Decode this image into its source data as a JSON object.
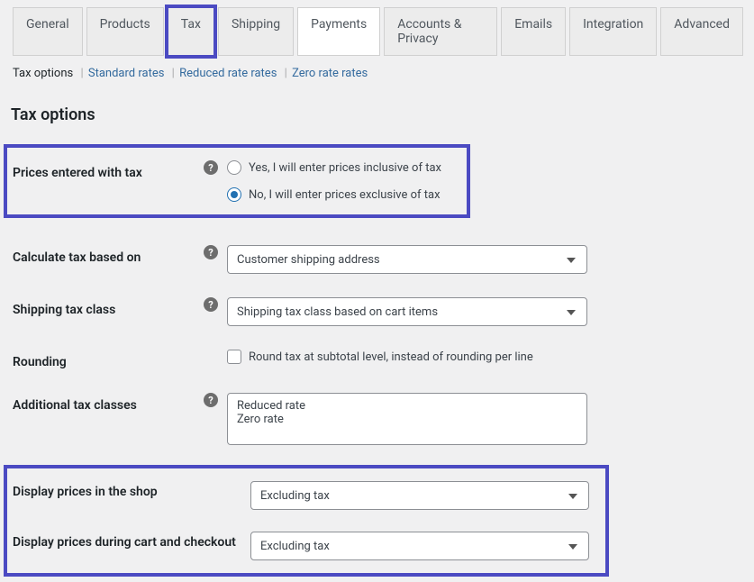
{
  "tabs": [
    {
      "label": "General"
    },
    {
      "label": "Products"
    },
    {
      "label": "Tax"
    },
    {
      "label": "Shipping"
    },
    {
      "label": "Payments"
    },
    {
      "label": "Accounts & Privacy"
    },
    {
      "label": "Emails"
    },
    {
      "label": "Integration"
    },
    {
      "label": "Advanced"
    }
  ],
  "subtabs": {
    "current": "Tax options",
    "links": [
      "Standard rates",
      "Reduced rate rates",
      "Zero rate rates"
    ]
  },
  "heading": "Tax options",
  "fields": {
    "prices_entered": {
      "label": "Prices entered with tax",
      "option1": "Yes, I will enter prices inclusive of tax",
      "option2": "No, I will enter prices exclusive of tax"
    },
    "calculate_based_on": {
      "label": "Calculate tax based on",
      "value": "Customer shipping address"
    },
    "shipping_tax_class": {
      "label": "Shipping tax class",
      "value": "Shipping tax class based on cart items"
    },
    "rounding": {
      "label": "Rounding",
      "text": "Round tax at subtotal level, instead of rounding per line"
    },
    "additional_classes": {
      "label": "Additional tax classes",
      "value": "Reduced rate\nZero rate"
    },
    "display_shop": {
      "label": "Display prices in the shop",
      "value": "Excluding tax"
    },
    "display_checkout": {
      "label": "Display prices during cart and checkout",
      "value": "Excluding tax"
    }
  }
}
